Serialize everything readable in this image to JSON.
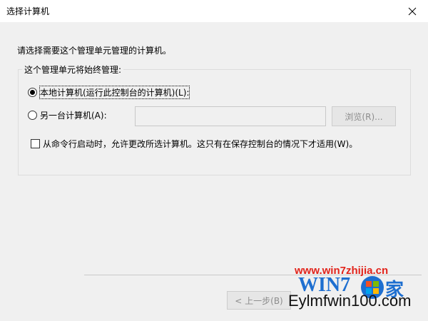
{
  "window": {
    "title": "选择计算机",
    "close_icon": "close-icon"
  },
  "instruction": "请选择需要这个管理单元管理的计算机。",
  "group": {
    "label": "这个管理单元将始终管理:",
    "local_option": {
      "label": "本地计算机(运行此控制台的计算机)(L):",
      "checked": true
    },
    "remote_option": {
      "label": "另一台计算机(A):",
      "checked": false,
      "value": ""
    },
    "browse_label": "浏览(R)...",
    "allow_change": {
      "label": "从命令行启动时，允许更改所选计算机。这只有在保存控制台的情况下才适用(W)。",
      "checked": false
    }
  },
  "footer": {
    "back_label": "< 上一步(B)"
  },
  "watermark": {
    "url_top": "www.win7zhijia.cn",
    "logo_text": "WIN7",
    "logo_char": "家",
    "url_bottom": "Eylmfwin100.com"
  }
}
